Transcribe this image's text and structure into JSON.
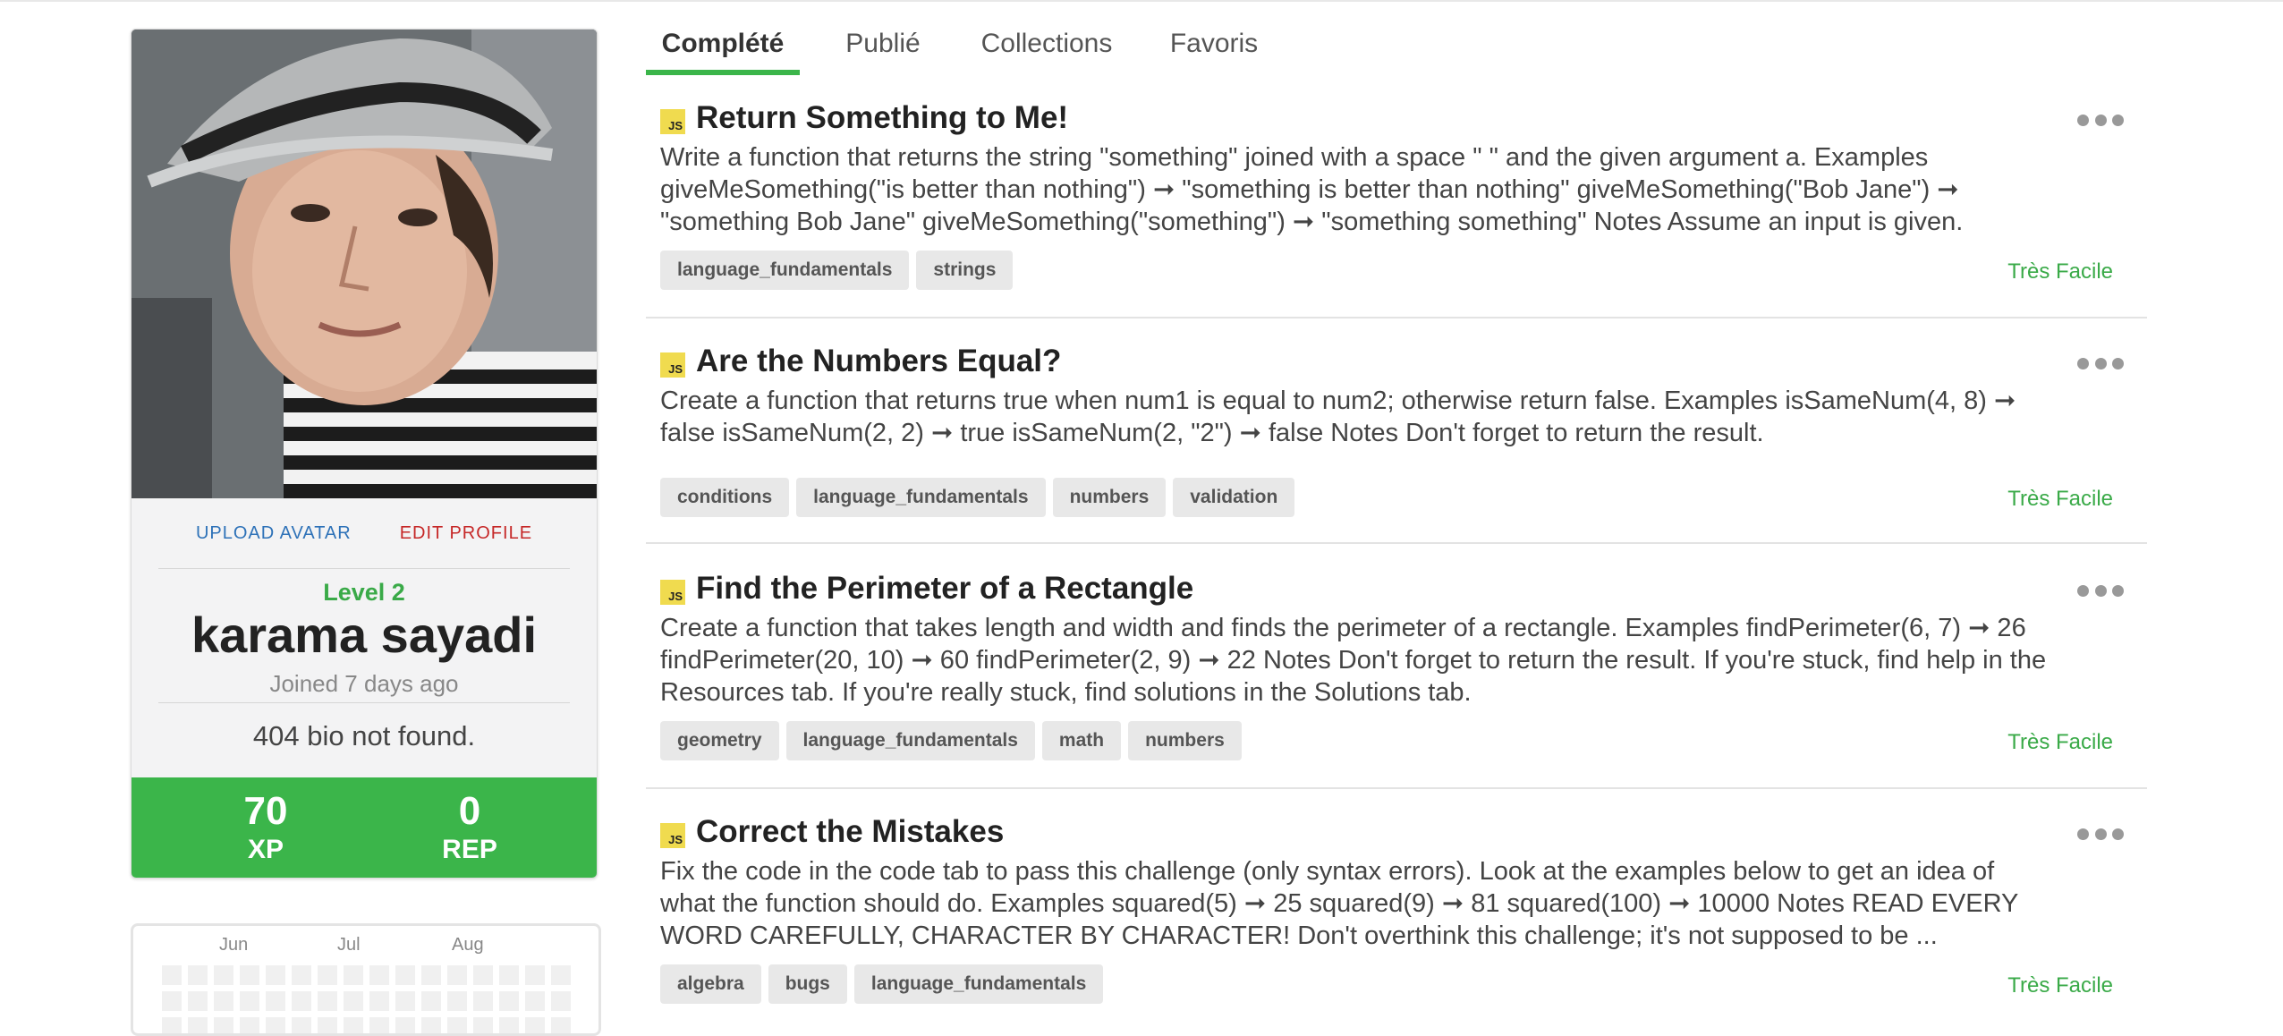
{
  "profile": {
    "upload_avatar": "UPLOAD AVATAR",
    "edit_profile": "EDIT PROFILE",
    "level": "Level 2",
    "name": "karama sayadi",
    "joined": "Joined 7 days ago",
    "bio": "404 bio not found.",
    "xp_value": "70",
    "xp_label": "XP",
    "rep_value": "0",
    "rep_label": "REP"
  },
  "calendar": {
    "months": [
      "Jun",
      "Jul",
      "Aug"
    ]
  },
  "tabs": [
    {
      "label": "Complété",
      "active": true
    },
    {
      "label": "Publié",
      "active": false
    },
    {
      "label": "Collections",
      "active": false
    },
    {
      "label": "Favoris",
      "active": false
    }
  ],
  "challenges": [
    {
      "lang": "JS",
      "title": "Return Something to Me!",
      "description": "Write a function that returns the string \"something\" joined with a space \" \" and the given argument a. Examples giveMeSomething(\"is better than nothing\") ➞ \"something is better than nothing\" giveMeSomething(\"Bob Jane\") ➞ \"something Bob Jane\" giveMeSomething(\"something\") ➞ \"something something\" Notes Assume an input is given.",
      "tags": [
        "language_fundamentals",
        "strings"
      ],
      "difficulty": "Très Facile"
    },
    {
      "lang": "JS",
      "title": "Are the Numbers Equal?",
      "description": "Create a function that returns true when num1 is equal to num2; otherwise return false. Examples isSameNum(4, 8) ➞ false isSameNum(2, 2) ➞ true isSameNum(2, \"2\") ➞ false Notes Don't forget to return the result.",
      "tags": [
        "conditions",
        "language_fundamentals",
        "numbers",
        "validation"
      ],
      "difficulty": "Très Facile"
    },
    {
      "lang": "JS",
      "title": "Find the Perimeter of a Rectangle",
      "description": "Create a function that takes length and width and finds the perimeter of a rectangle. Examples findPerimeter(6, 7) ➞ 26 findPerimeter(20, 10) ➞ 60 findPerimeter(2, 9) ➞ 22 Notes Don't forget to return the result. If you're stuck, find help in the Resources tab. If you're really stuck, find solutions in the Solutions tab.",
      "tags": [
        "geometry",
        "language_fundamentals",
        "math",
        "numbers"
      ],
      "difficulty": "Très Facile"
    },
    {
      "lang": "JS",
      "title": "Correct the Mistakes",
      "description": "Fix the code in the code tab to pass this challenge (only syntax errors). Look at the examples below to get an idea of what the function should do. Examples squared(5) ➞ 25 squared(9) ➞ 81 squared(100) ➞ 10000 Notes READ EVERY WORD CAREFULLY, CHARACTER BY CHARACTER! Don't overthink this challenge; it's not supposed to be ...",
      "tags": [
        "algebra",
        "bugs",
        "language_fundamentals"
      ],
      "difficulty": "Très Facile"
    }
  ],
  "colors": {
    "accent_green": "#3bb54a",
    "link_blue": "#2e72b8",
    "edit_red": "#c62828",
    "js_yellow": "#f0db4f"
  }
}
